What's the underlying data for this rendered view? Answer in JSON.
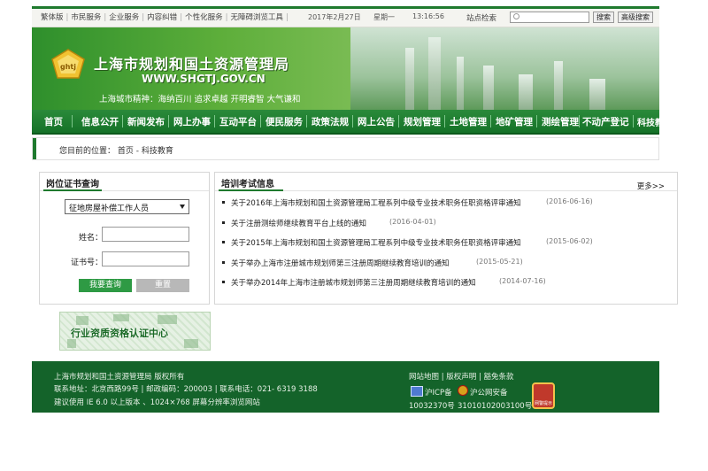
{
  "topbar": {
    "links": [
      "繁体版",
      "市民服务",
      "企业服务",
      "内容纠错",
      "个性化服务",
      "无障碍浏览工具"
    ],
    "date": "2017年2月27日",
    "weekday": "星期一",
    "time": "13:16:56",
    "search_label": "站点检索",
    "search_value": "",
    "search_button": "搜索",
    "advanced_button": "高级搜索"
  },
  "banner": {
    "logo_text": "ghtj",
    "title": "上海市规划和国土资源管理局",
    "url": "WWW.SHGTJ.GOV.CN",
    "spirit": "上海城市精神：海纳百川  追求卓越  开明睿智  大气谦和"
  },
  "nav": [
    "首页",
    "信息公开",
    "新闻发布",
    "网上办事",
    "互动平台",
    "便民服务",
    "政策法规",
    "网上公告",
    "规划管理",
    "土地管理",
    "地矿管理",
    "测绘管理",
    "不动产登记",
    "科技教育"
  ],
  "breadcrumb": "您目前的位置：  首页  -  科技教育",
  "cert": {
    "title": "岗位证书查询",
    "select_value": "征地房屋补偿工作人员",
    "name_label": "姓名：",
    "cert_label": "证书号：",
    "search_button": "我要查询",
    "reset_button": "重置"
  },
  "training": {
    "title": "培训考试信息",
    "more": "更多>>",
    "items": [
      {
        "text": "关于2016年上海市规划和国土资源管理局工程系列中级专业技术职务任职资格评审通知",
        "date": "(2016-06-16)"
      },
      {
        "text": "关于注册测绘师继续教育平台上线的通知",
        "date": "(2016-04-01)"
      },
      {
        "text": "关于2015年上海市规划和国土资源管理局工程系列中级专业技术职务任职资格评审通知",
        "date": "(2015-06-02)"
      },
      {
        "text": "关于举办上海市注册城市规划师第三注册周期继续教育培训的通知",
        "date": "(2015-05-21)"
      },
      {
        "text": "关于举办2014年上海市注册城市规划师第三注册周期继续教育培训的通知",
        "date": "(2014-07-16)"
      }
    ]
  },
  "qualification_banner": "行业资质资格认证中心",
  "footer": {
    "copyright": "上海市规划和国土资源管理局  版权所有",
    "address": "联系地址：北京西路99号  |  邮政编码：200003  |  联系电话：021- 6319 3188",
    "browser": "建议使用  IE 6.0  以上版本 、1024×768   屏幕分辨率浏览网站",
    "links": "网站地图  |  版权声明  |  豁免条款",
    "icp_label": "沪ICP备",
    "police_label": "沪公网安备",
    "icp_number": "10032370号",
    "police_number": "31010102003100号",
    "emblem_text": "网警提示"
  }
}
